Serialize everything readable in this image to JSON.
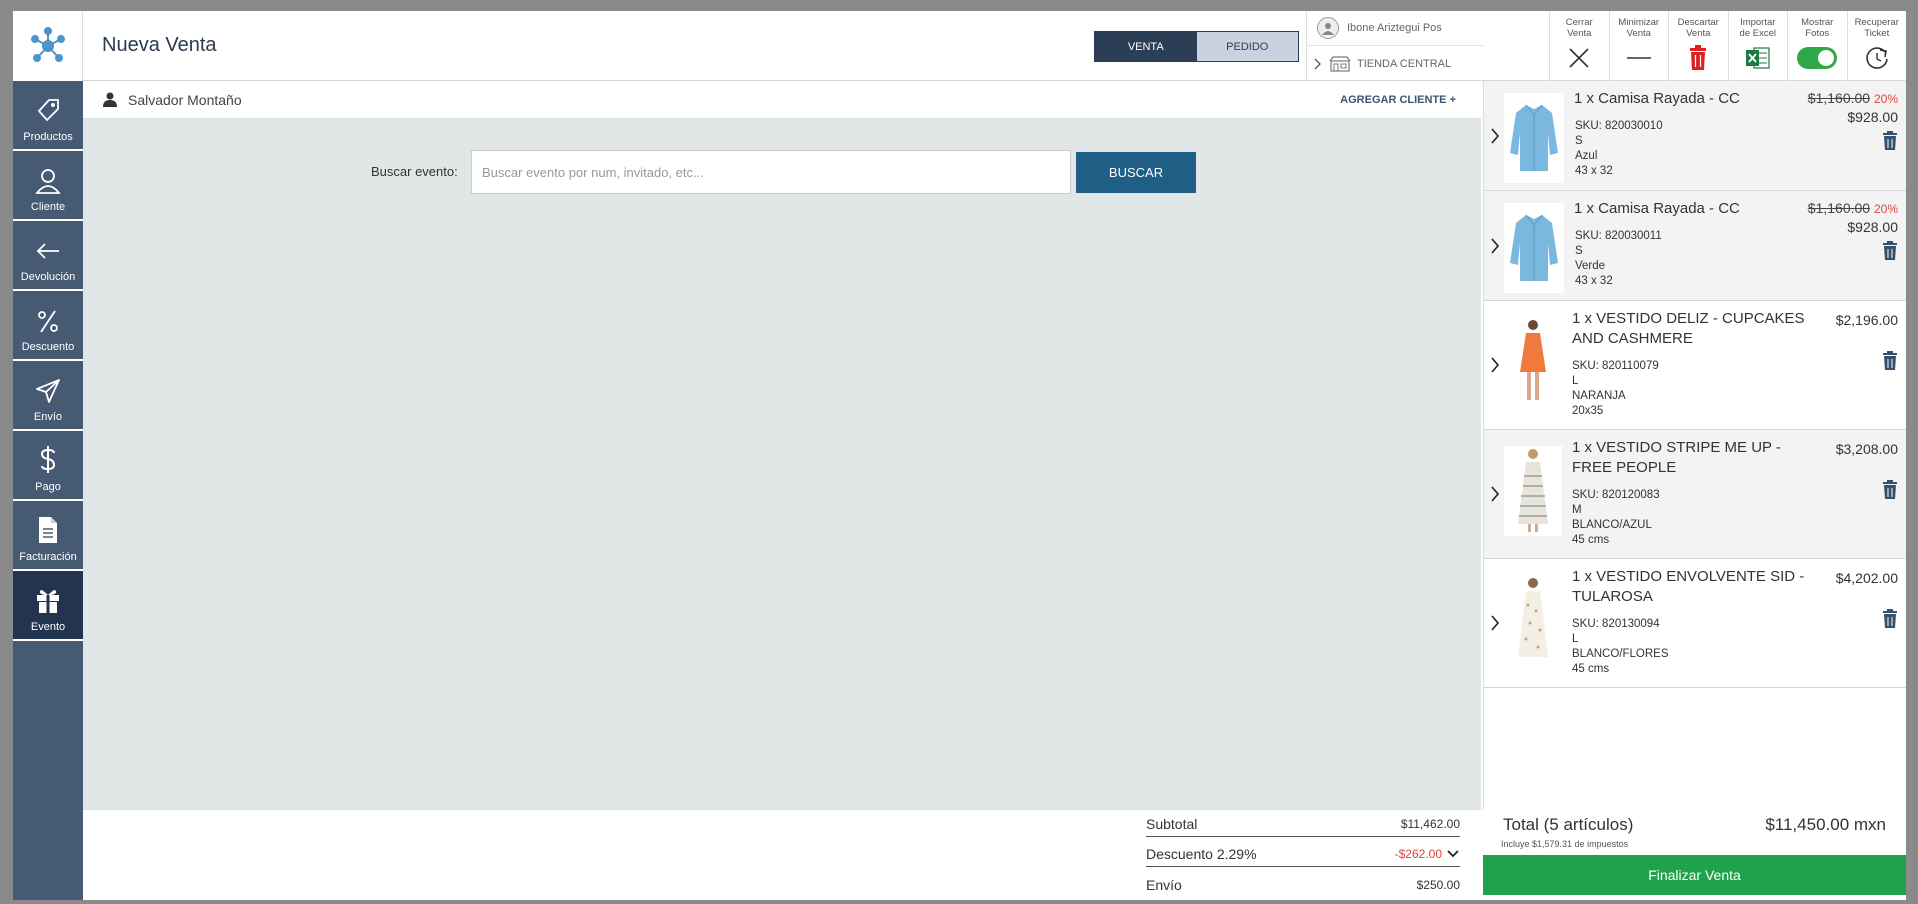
{
  "header": {
    "title": "Nueva Venta",
    "mode_tabs": [
      "VENTA",
      "PEDIDO"
    ],
    "user": "Ibone Ariztegui Pos",
    "store": "TIENDA CENTRAL",
    "tools": [
      {
        "label": "Cerrar Venta",
        "icon": "close-icon"
      },
      {
        "label": "Minimizar Venta",
        "icon": "minimize-icon"
      },
      {
        "label": "Descartar Venta",
        "icon": "trash-icon"
      },
      {
        "label": "Importar de Excel",
        "icon": "excel-icon"
      },
      {
        "label": "Mostrar Fotos",
        "icon": "toggle-switch",
        "on": true
      },
      {
        "label": "Recuperar Ticket",
        "icon": "refresh-icon"
      }
    ]
  },
  "sidebar": {
    "items": [
      {
        "label": "Productos",
        "icon": "tag-icon"
      },
      {
        "label": "Cliente",
        "icon": "user-icon"
      },
      {
        "label": "Devolución",
        "icon": "arrow-left-icon"
      },
      {
        "label": "Descuento",
        "icon": "percent-icon"
      },
      {
        "label": "Envío",
        "icon": "send-icon"
      },
      {
        "label": "Pago",
        "icon": "dollar-icon"
      },
      {
        "label": "Facturación",
        "icon": "document-icon"
      },
      {
        "label": "Evento",
        "icon": "gift-icon",
        "active": true
      }
    ]
  },
  "client": {
    "name": "Salvador Montaño",
    "add_label": "AGREGAR CLIENTE +"
  },
  "search": {
    "label": "Buscar evento:",
    "placeholder": "Buscar evento por num, invitado, etc...",
    "button": "BUSCAR"
  },
  "summary": {
    "subtotal_label": "Subtotal",
    "subtotal": "$11,462.00",
    "discount_label": "Descuento 2.29%",
    "discount": "-$262.00",
    "shipping_label": "Envío",
    "shipping": "$250.00"
  },
  "cart": {
    "items": [
      {
        "name": "1 x Camisa Rayada - CC",
        "sku": "SKU: 820030010",
        "size": "S",
        "color": "Azul",
        "measure": "43 x 32",
        "old_price": "$1,160.00",
        "pct": "20%",
        "price": "$928.00",
        "image": "shirt-blue"
      },
      {
        "name": "1 x Camisa Rayada - CC",
        "sku": "SKU: 820030011",
        "size": "S",
        "color": "Verde",
        "measure": "43 x 32",
        "old_price": "$1,160.00",
        "pct": "20%",
        "price": "$928.00",
        "image": "shirt-blue"
      },
      {
        "name": "1 x VESTIDO DELIZ - CUPCAKES AND CASHMERE",
        "sku": "SKU: 820110079",
        "size": "L",
        "color": "NARANJA",
        "measure": "20x35",
        "price": "$2,196.00",
        "image": "dress-orange"
      },
      {
        "name": "1 x VESTIDO STRIPE ME UP - FREE PEOPLE",
        "sku": "SKU: 820120083",
        "size": "M",
        "color": "BLANCO/AZUL",
        "measure": "45 cms",
        "price": "$3,208.00",
        "image": "dress-striped"
      },
      {
        "name": "1 x VESTIDO ENVOLVENTE SID - TULAROSA",
        "sku": "SKU: 820130094",
        "size": "L",
        "color": "BLANCO/FLORES",
        "measure": "45 cms",
        "price": "$4,202.00",
        "image": "dress-floral"
      }
    ],
    "total_label": "Total (5 artículos)",
    "total": "$11,450.00 mxn",
    "tax_note": "Incluye $1,579.31 de impuestos",
    "finalize": "Finalizar Venta"
  },
  "colors": {
    "sidebar": "#475a73",
    "sidebar_active": "#22344f",
    "primary_button": "#1f5f86",
    "finalize": "#1fa24a",
    "discount": "#e0443c"
  }
}
